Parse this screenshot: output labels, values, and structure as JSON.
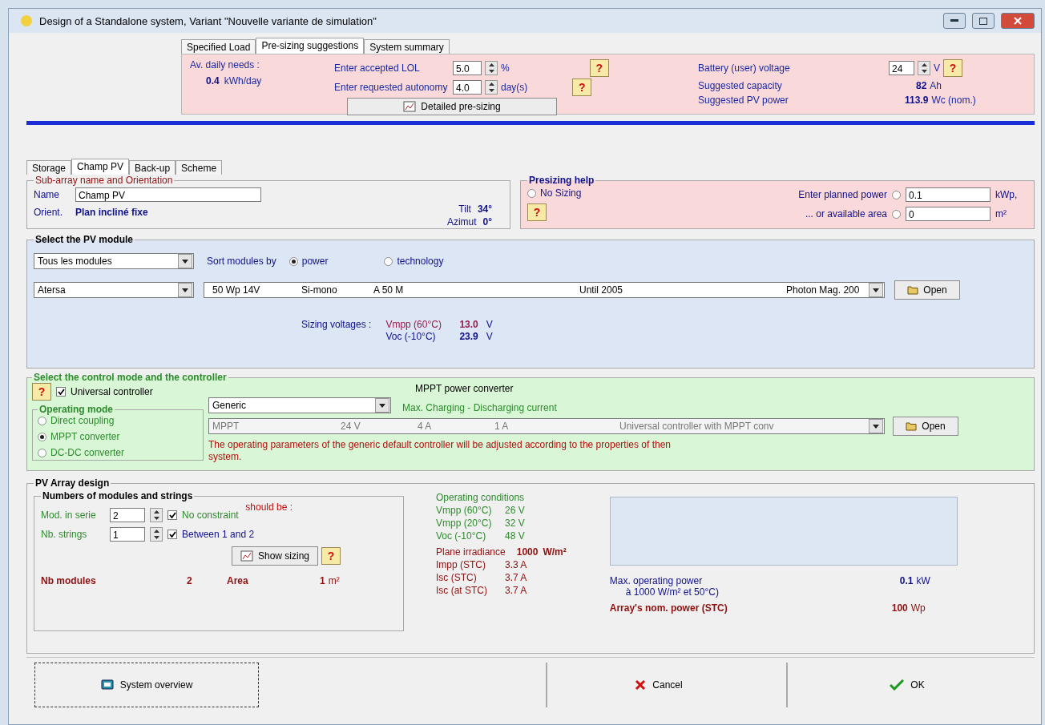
{
  "window": {
    "title": "Design of a Standalone system, Variant  \"Nouvelle variante de simulation\""
  },
  "top_tabs": [
    {
      "label": "Specified Load",
      "selected": false
    },
    {
      "label": "Pre-sizing suggestions",
      "selected": true
    },
    {
      "label": "System summary",
      "selected": false
    }
  ],
  "presizing": {
    "av_daily_label": "Av. daily needs :",
    "av_daily_value": "0.4",
    "av_daily_unit": "kWh/day",
    "lol_label": "Enter accepted LOL",
    "lol_value": "5.0",
    "lol_unit": "%",
    "lol_help": "?",
    "autonomy_label": "Enter requested autonomy",
    "autonomy_value": "4.0",
    "autonomy_unit": "day(s)",
    "autonomy_help": "?",
    "detailed_button": "Detailed pre-sizing",
    "battery_label": "Battery (user) voltage",
    "battery_value": "24",
    "battery_unit": "V",
    "battery_help": "?",
    "capacity_label": "Suggested capacity",
    "capacity_value": "82",
    "capacity_unit": "Ah",
    "pv_label": "Suggested PV power",
    "pv_value": "113.9",
    "pv_unit": "Wc (nom.)"
  },
  "sub_tabs": [
    {
      "label": "Storage",
      "selected": false
    },
    {
      "label": "Champ PV",
      "selected": true
    },
    {
      "label": "Back-up",
      "selected": false
    },
    {
      "label": "Scheme",
      "selected": false
    }
  ],
  "sub_array": {
    "legend": "Sub-array name and Orientation",
    "name_label": "Name",
    "name_value": "Champ PV",
    "orient_label": "Orient.",
    "orient_value": "Plan incliné fixe",
    "tilt_label": "Tilt",
    "tilt_value": "34°",
    "azimut_label": "Azimut",
    "azimut_value": "0°"
  },
  "presizing_help": {
    "legend": "Presizing help",
    "help": "?",
    "no_sizing": {
      "label": "No Sizing",
      "selected": false
    },
    "power": {
      "label": "Enter planned power",
      "selected": false,
      "value": "0.1",
      "unit": "kWp,"
    },
    "area": {
      "label": "... or available area",
      "selected": false,
      "value": "0",
      "unit": "m²"
    }
  },
  "pv_module": {
    "legend": "Select the PV module",
    "filter": "Tous les modules",
    "sort_label": "Sort modules by",
    "sort_options": [
      {
        "label": "power",
        "selected": true
      },
      {
        "label": "technology",
        "selected": false
      }
    ],
    "manufacturer": "Atersa",
    "module": {
      "power": "50 Wp 14V",
      "tech": "Si-mono",
      "model": "A 50 M",
      "date": "Until 2005",
      "source": "Photon Mag. 200"
    },
    "open_button": "Open",
    "sizing_label": "Sizing voltages :",
    "voltages": [
      {
        "label": "Vmpp (60°C)",
        "value": "13.0",
        "unit": "V"
      },
      {
        "label": "Voc  (-10°C)",
        "value": "23.9",
        "unit": "V"
      }
    ]
  },
  "controller": {
    "legend": "Select the control mode and the controller",
    "help": "?",
    "universal": {
      "label": "Universal controller",
      "checked": true
    },
    "mode_legend": "Operating mode",
    "modes": [
      {
        "label": "Direct coupling",
        "selected": false
      },
      {
        "label": "MPPT converter",
        "selected": true
      },
      {
        "label": "DC-DC converter",
        "selected": false
      }
    ],
    "converter_title": "MPPT power converter",
    "brand": "Generic",
    "current_label": "Max. Charging - Discharging current",
    "device": {
      "type": "MPPT",
      "voltage": "24 V",
      "charge": "4 A",
      "discharge": "1 A",
      "name": "Universal controller with MPPT conv"
    },
    "open_button": "Open",
    "note": "The operating parameters of the generic default controller will be adjusted according to the properties of then system."
  },
  "array": {
    "legend": "PV Array design",
    "strings_legend": "Numbers of modules and strings",
    "should_be": "should be :",
    "rows": [
      {
        "label": "Mod. in serie",
        "value": "2",
        "constraint": "No constraint",
        "checked": true
      },
      {
        "label": "Nb. strings",
        "value": "1",
        "constraint": "Between 1 and 2",
        "checked": true
      }
    ],
    "show_sizing": "Show sizing",
    "help": "?",
    "nb_modules_label": "Nb modules",
    "nb_modules_value": "2",
    "area_label": "Area",
    "area_value": "1",
    "area_unit": "m²",
    "operating_title": "Operating conditions",
    "operating": [
      {
        "label": "Vmpp (60°C)",
        "value": "26 V"
      },
      {
        "label": "Vmpp (20°C)",
        "value": "32 V"
      },
      {
        "label": "Voc  (-10°C)",
        "value": "48 V"
      }
    ],
    "irradiance_label": "Plane irradiance",
    "irradiance_value": "1000",
    "irradiance_unit": "W/m²",
    "currents": [
      {
        "label": "Impp (STC)",
        "value": "3.3 A"
      },
      {
        "label": "Isc  (STC)",
        "value": "3.7 A"
      },
      {
        "label": "Isc  (at STC)",
        "value": "3.7 A"
      }
    ],
    "max_power_label": "Max. operating power",
    "max_power_value": "0.1",
    "max_power_unit": "kW",
    "max_power_note": "à 1000 W/m² et 50°C)",
    "nominal_label": "Array's nom. power (STC)",
    "nominal_value": "100",
    "nominal_unit": "Wp"
  },
  "buttons": [
    {
      "label": "System overview",
      "kind": "overview"
    },
    {
      "label": "Cancel",
      "kind": "cancel"
    },
    {
      "label": "OK",
      "kind": "ok"
    }
  ]
}
